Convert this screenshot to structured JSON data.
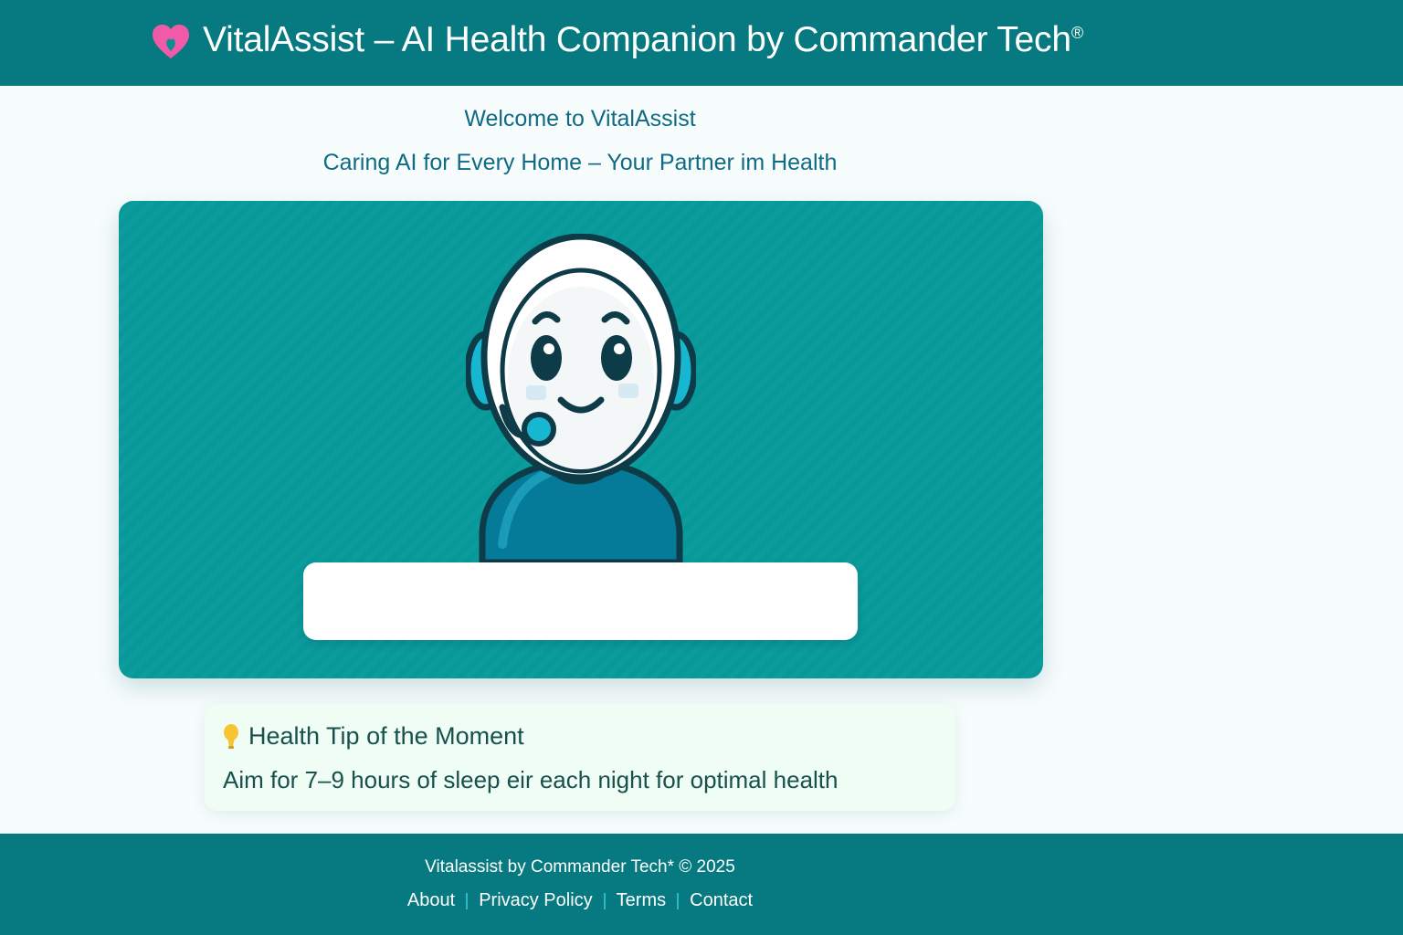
{
  "header": {
    "title": "VitalAssist – AI Health Companion by Commander Tech",
    "trademark": "®",
    "logo_icon": "heart-icon"
  },
  "hero": {
    "welcome": "Welcome to VitalAssist",
    "tagline": "Caring AI for Every Home – Your Partner im Health",
    "avatar": "assistant-avatar-with-headset",
    "input_value": "",
    "input_placeholder": ""
  },
  "tip": {
    "icon": "lightbulb-icon",
    "title": "Health Tip of the Moment",
    "text": "Aim for 7–9 hours of sleep eir each night for optimal health"
  },
  "footer": {
    "copyright": "Vitalassist by Commander Tech* © 2025",
    "links": [
      "About",
      "Privacy Policy",
      "Terms",
      "Contact"
    ]
  },
  "colors": {
    "header_bg": "#067a80",
    "hero_bg": "#07999a",
    "accent_pink": "#f05aa8",
    "tip_bg": "#effdf4",
    "text_dark": "#17504d"
  }
}
